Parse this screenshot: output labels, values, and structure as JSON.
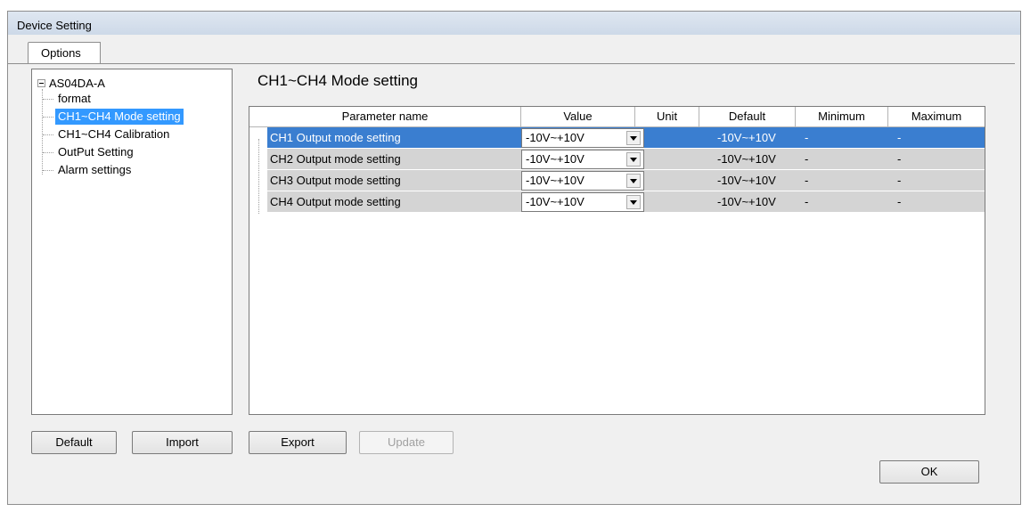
{
  "window": {
    "title": "Device Setting"
  },
  "tabs": [
    {
      "label": "Options"
    }
  ],
  "tree": {
    "root": "AS04DA-A",
    "items": [
      {
        "label": "format"
      },
      {
        "label": "CH1~CH4 Mode setting",
        "selected": true
      },
      {
        "label": "CH1~CH4 Calibration"
      },
      {
        "label": "OutPut Setting"
      },
      {
        "label": "Alarm settings"
      }
    ]
  },
  "main": {
    "section_title": "CH1~CH4 Mode setting",
    "columns": [
      "Parameter name",
      "Value",
      "Unit",
      "Default",
      "Minimum",
      "Maximum"
    ],
    "rows": [
      {
        "name": "CH1 Output mode setting",
        "value": "-10V~+10V",
        "unit": "",
        "default": "-10V~+10V",
        "min": "-",
        "max": "-"
      },
      {
        "name": "CH2 Output mode setting",
        "value": "-10V~+10V",
        "unit": "",
        "default": "-10V~+10V",
        "min": "-",
        "max": "-"
      },
      {
        "name": "CH3 Output mode setting",
        "value": "-10V~+10V",
        "unit": "",
        "default": "-10V~+10V",
        "min": "-",
        "max": "-"
      },
      {
        "name": "CH4 Output mode setting",
        "value": "-10V~+10V",
        "unit": "",
        "default": "-10V~+10V",
        "min": "-",
        "max": "-"
      }
    ]
  },
  "buttons": {
    "default": "Default",
    "import": "Import",
    "export": "Export",
    "update": "Update",
    "ok": "OK"
  },
  "colors": {
    "selection": "#3399ff",
    "row_selected": "#3a7ed0",
    "row_bg": "#d4d4d4"
  }
}
